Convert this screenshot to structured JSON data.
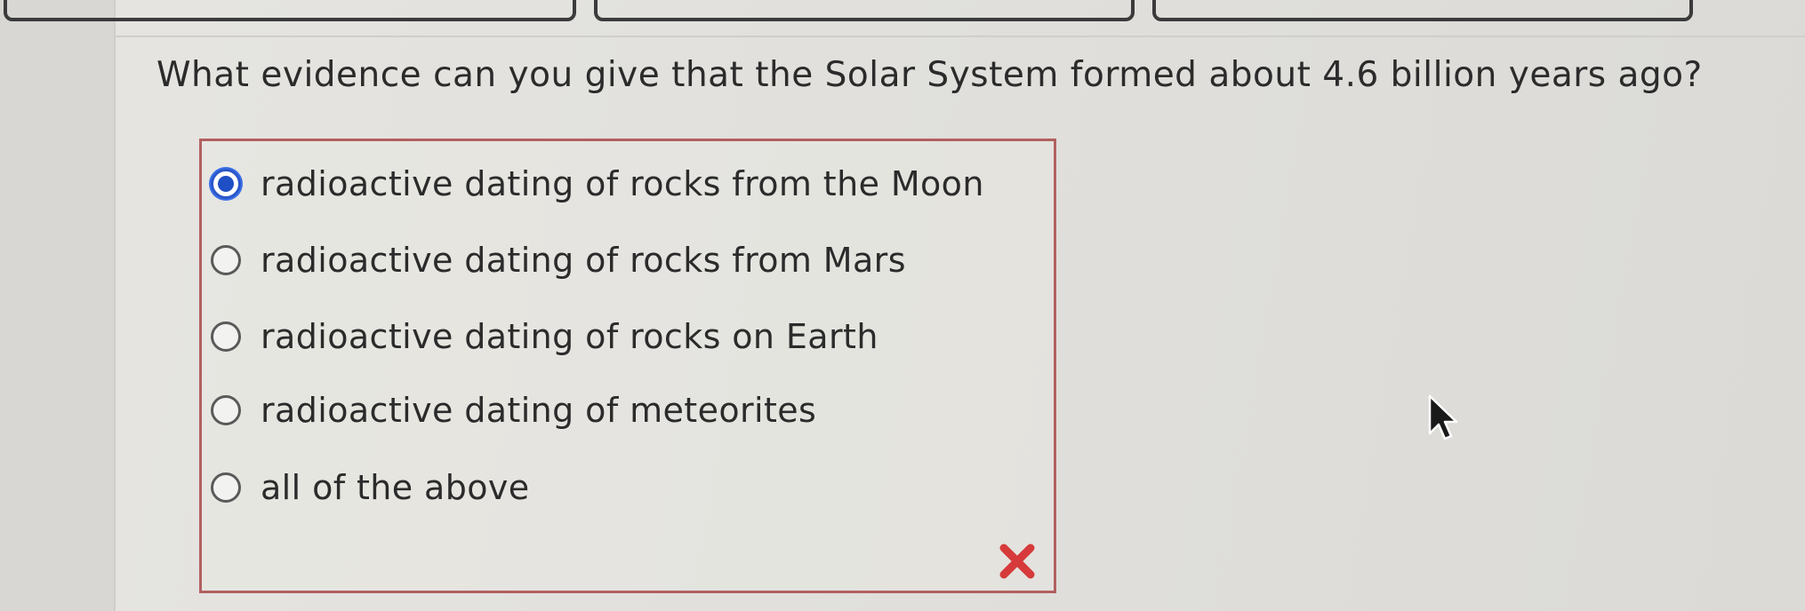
{
  "question": {
    "text": "What evidence can you give that the Solar System formed about 4.6 billion years ago?"
  },
  "options": [
    {
      "label": "radioactive dating of rocks from the Moon",
      "selected": true
    },
    {
      "label": "radioactive dating of rocks from Mars",
      "selected": false
    },
    {
      "label": "radioactive dating of rocks on Earth",
      "selected": false
    },
    {
      "label": "radioactive dating of meteorites",
      "selected": false
    },
    {
      "label": "all of the above",
      "selected": false
    }
  ],
  "feedback": {
    "icon": "x-mark-icon",
    "color": "#d63a3a"
  },
  "colors": {
    "box_border": "#b26060",
    "radio_selected": "#1f4fc4"
  }
}
